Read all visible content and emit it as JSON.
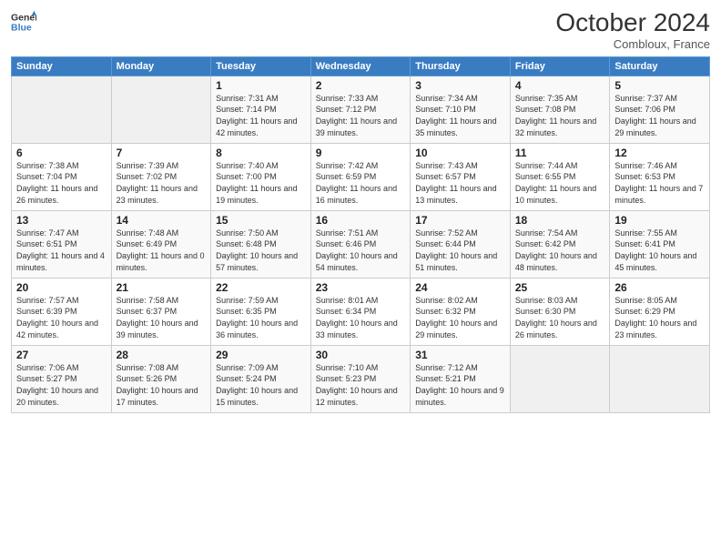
{
  "header": {
    "logo_line1": "General",
    "logo_line2": "Blue",
    "month": "October 2024",
    "location": "Combloux, France"
  },
  "days_of_week": [
    "Sunday",
    "Monday",
    "Tuesday",
    "Wednesday",
    "Thursday",
    "Friday",
    "Saturday"
  ],
  "weeks": [
    [
      {
        "day": "",
        "sunrise": "",
        "sunset": "",
        "daylight": ""
      },
      {
        "day": "",
        "sunrise": "",
        "sunset": "",
        "daylight": ""
      },
      {
        "day": "1",
        "sunrise": "Sunrise: 7:31 AM",
        "sunset": "Sunset: 7:14 PM",
        "daylight": "Daylight: 11 hours and 42 minutes."
      },
      {
        "day": "2",
        "sunrise": "Sunrise: 7:33 AM",
        "sunset": "Sunset: 7:12 PM",
        "daylight": "Daylight: 11 hours and 39 minutes."
      },
      {
        "day": "3",
        "sunrise": "Sunrise: 7:34 AM",
        "sunset": "Sunset: 7:10 PM",
        "daylight": "Daylight: 11 hours and 35 minutes."
      },
      {
        "day": "4",
        "sunrise": "Sunrise: 7:35 AM",
        "sunset": "Sunset: 7:08 PM",
        "daylight": "Daylight: 11 hours and 32 minutes."
      },
      {
        "day": "5",
        "sunrise": "Sunrise: 7:37 AM",
        "sunset": "Sunset: 7:06 PM",
        "daylight": "Daylight: 11 hours and 29 minutes."
      }
    ],
    [
      {
        "day": "6",
        "sunrise": "Sunrise: 7:38 AM",
        "sunset": "Sunset: 7:04 PM",
        "daylight": "Daylight: 11 hours and 26 minutes."
      },
      {
        "day": "7",
        "sunrise": "Sunrise: 7:39 AM",
        "sunset": "Sunset: 7:02 PM",
        "daylight": "Daylight: 11 hours and 23 minutes."
      },
      {
        "day": "8",
        "sunrise": "Sunrise: 7:40 AM",
        "sunset": "Sunset: 7:00 PM",
        "daylight": "Daylight: 11 hours and 19 minutes."
      },
      {
        "day": "9",
        "sunrise": "Sunrise: 7:42 AM",
        "sunset": "Sunset: 6:59 PM",
        "daylight": "Daylight: 11 hours and 16 minutes."
      },
      {
        "day": "10",
        "sunrise": "Sunrise: 7:43 AM",
        "sunset": "Sunset: 6:57 PM",
        "daylight": "Daylight: 11 hours and 13 minutes."
      },
      {
        "day": "11",
        "sunrise": "Sunrise: 7:44 AM",
        "sunset": "Sunset: 6:55 PM",
        "daylight": "Daylight: 11 hours and 10 minutes."
      },
      {
        "day": "12",
        "sunrise": "Sunrise: 7:46 AM",
        "sunset": "Sunset: 6:53 PM",
        "daylight": "Daylight: 11 hours and 7 minutes."
      }
    ],
    [
      {
        "day": "13",
        "sunrise": "Sunrise: 7:47 AM",
        "sunset": "Sunset: 6:51 PM",
        "daylight": "Daylight: 11 hours and 4 minutes."
      },
      {
        "day": "14",
        "sunrise": "Sunrise: 7:48 AM",
        "sunset": "Sunset: 6:49 PM",
        "daylight": "Daylight: 11 hours and 0 minutes."
      },
      {
        "day": "15",
        "sunrise": "Sunrise: 7:50 AM",
        "sunset": "Sunset: 6:48 PM",
        "daylight": "Daylight: 10 hours and 57 minutes."
      },
      {
        "day": "16",
        "sunrise": "Sunrise: 7:51 AM",
        "sunset": "Sunset: 6:46 PM",
        "daylight": "Daylight: 10 hours and 54 minutes."
      },
      {
        "day": "17",
        "sunrise": "Sunrise: 7:52 AM",
        "sunset": "Sunset: 6:44 PM",
        "daylight": "Daylight: 10 hours and 51 minutes."
      },
      {
        "day": "18",
        "sunrise": "Sunrise: 7:54 AM",
        "sunset": "Sunset: 6:42 PM",
        "daylight": "Daylight: 10 hours and 48 minutes."
      },
      {
        "day": "19",
        "sunrise": "Sunrise: 7:55 AM",
        "sunset": "Sunset: 6:41 PM",
        "daylight": "Daylight: 10 hours and 45 minutes."
      }
    ],
    [
      {
        "day": "20",
        "sunrise": "Sunrise: 7:57 AM",
        "sunset": "Sunset: 6:39 PM",
        "daylight": "Daylight: 10 hours and 42 minutes."
      },
      {
        "day": "21",
        "sunrise": "Sunrise: 7:58 AM",
        "sunset": "Sunset: 6:37 PM",
        "daylight": "Daylight: 10 hours and 39 minutes."
      },
      {
        "day": "22",
        "sunrise": "Sunrise: 7:59 AM",
        "sunset": "Sunset: 6:35 PM",
        "daylight": "Daylight: 10 hours and 36 minutes."
      },
      {
        "day": "23",
        "sunrise": "Sunrise: 8:01 AM",
        "sunset": "Sunset: 6:34 PM",
        "daylight": "Daylight: 10 hours and 33 minutes."
      },
      {
        "day": "24",
        "sunrise": "Sunrise: 8:02 AM",
        "sunset": "Sunset: 6:32 PM",
        "daylight": "Daylight: 10 hours and 29 minutes."
      },
      {
        "day": "25",
        "sunrise": "Sunrise: 8:03 AM",
        "sunset": "Sunset: 6:30 PM",
        "daylight": "Daylight: 10 hours and 26 minutes."
      },
      {
        "day": "26",
        "sunrise": "Sunrise: 8:05 AM",
        "sunset": "Sunset: 6:29 PM",
        "daylight": "Daylight: 10 hours and 23 minutes."
      }
    ],
    [
      {
        "day": "27",
        "sunrise": "Sunrise: 7:06 AM",
        "sunset": "Sunset: 5:27 PM",
        "daylight": "Daylight: 10 hours and 20 minutes."
      },
      {
        "day": "28",
        "sunrise": "Sunrise: 7:08 AM",
        "sunset": "Sunset: 5:26 PM",
        "daylight": "Daylight: 10 hours and 17 minutes."
      },
      {
        "day": "29",
        "sunrise": "Sunrise: 7:09 AM",
        "sunset": "Sunset: 5:24 PM",
        "daylight": "Daylight: 10 hours and 15 minutes."
      },
      {
        "day": "30",
        "sunrise": "Sunrise: 7:10 AM",
        "sunset": "Sunset: 5:23 PM",
        "daylight": "Daylight: 10 hours and 12 minutes."
      },
      {
        "day": "31",
        "sunrise": "Sunrise: 7:12 AM",
        "sunset": "Sunset: 5:21 PM",
        "daylight": "Daylight: 10 hours and 9 minutes."
      },
      {
        "day": "",
        "sunrise": "",
        "sunset": "",
        "daylight": ""
      },
      {
        "day": "",
        "sunrise": "",
        "sunset": "",
        "daylight": ""
      }
    ]
  ]
}
